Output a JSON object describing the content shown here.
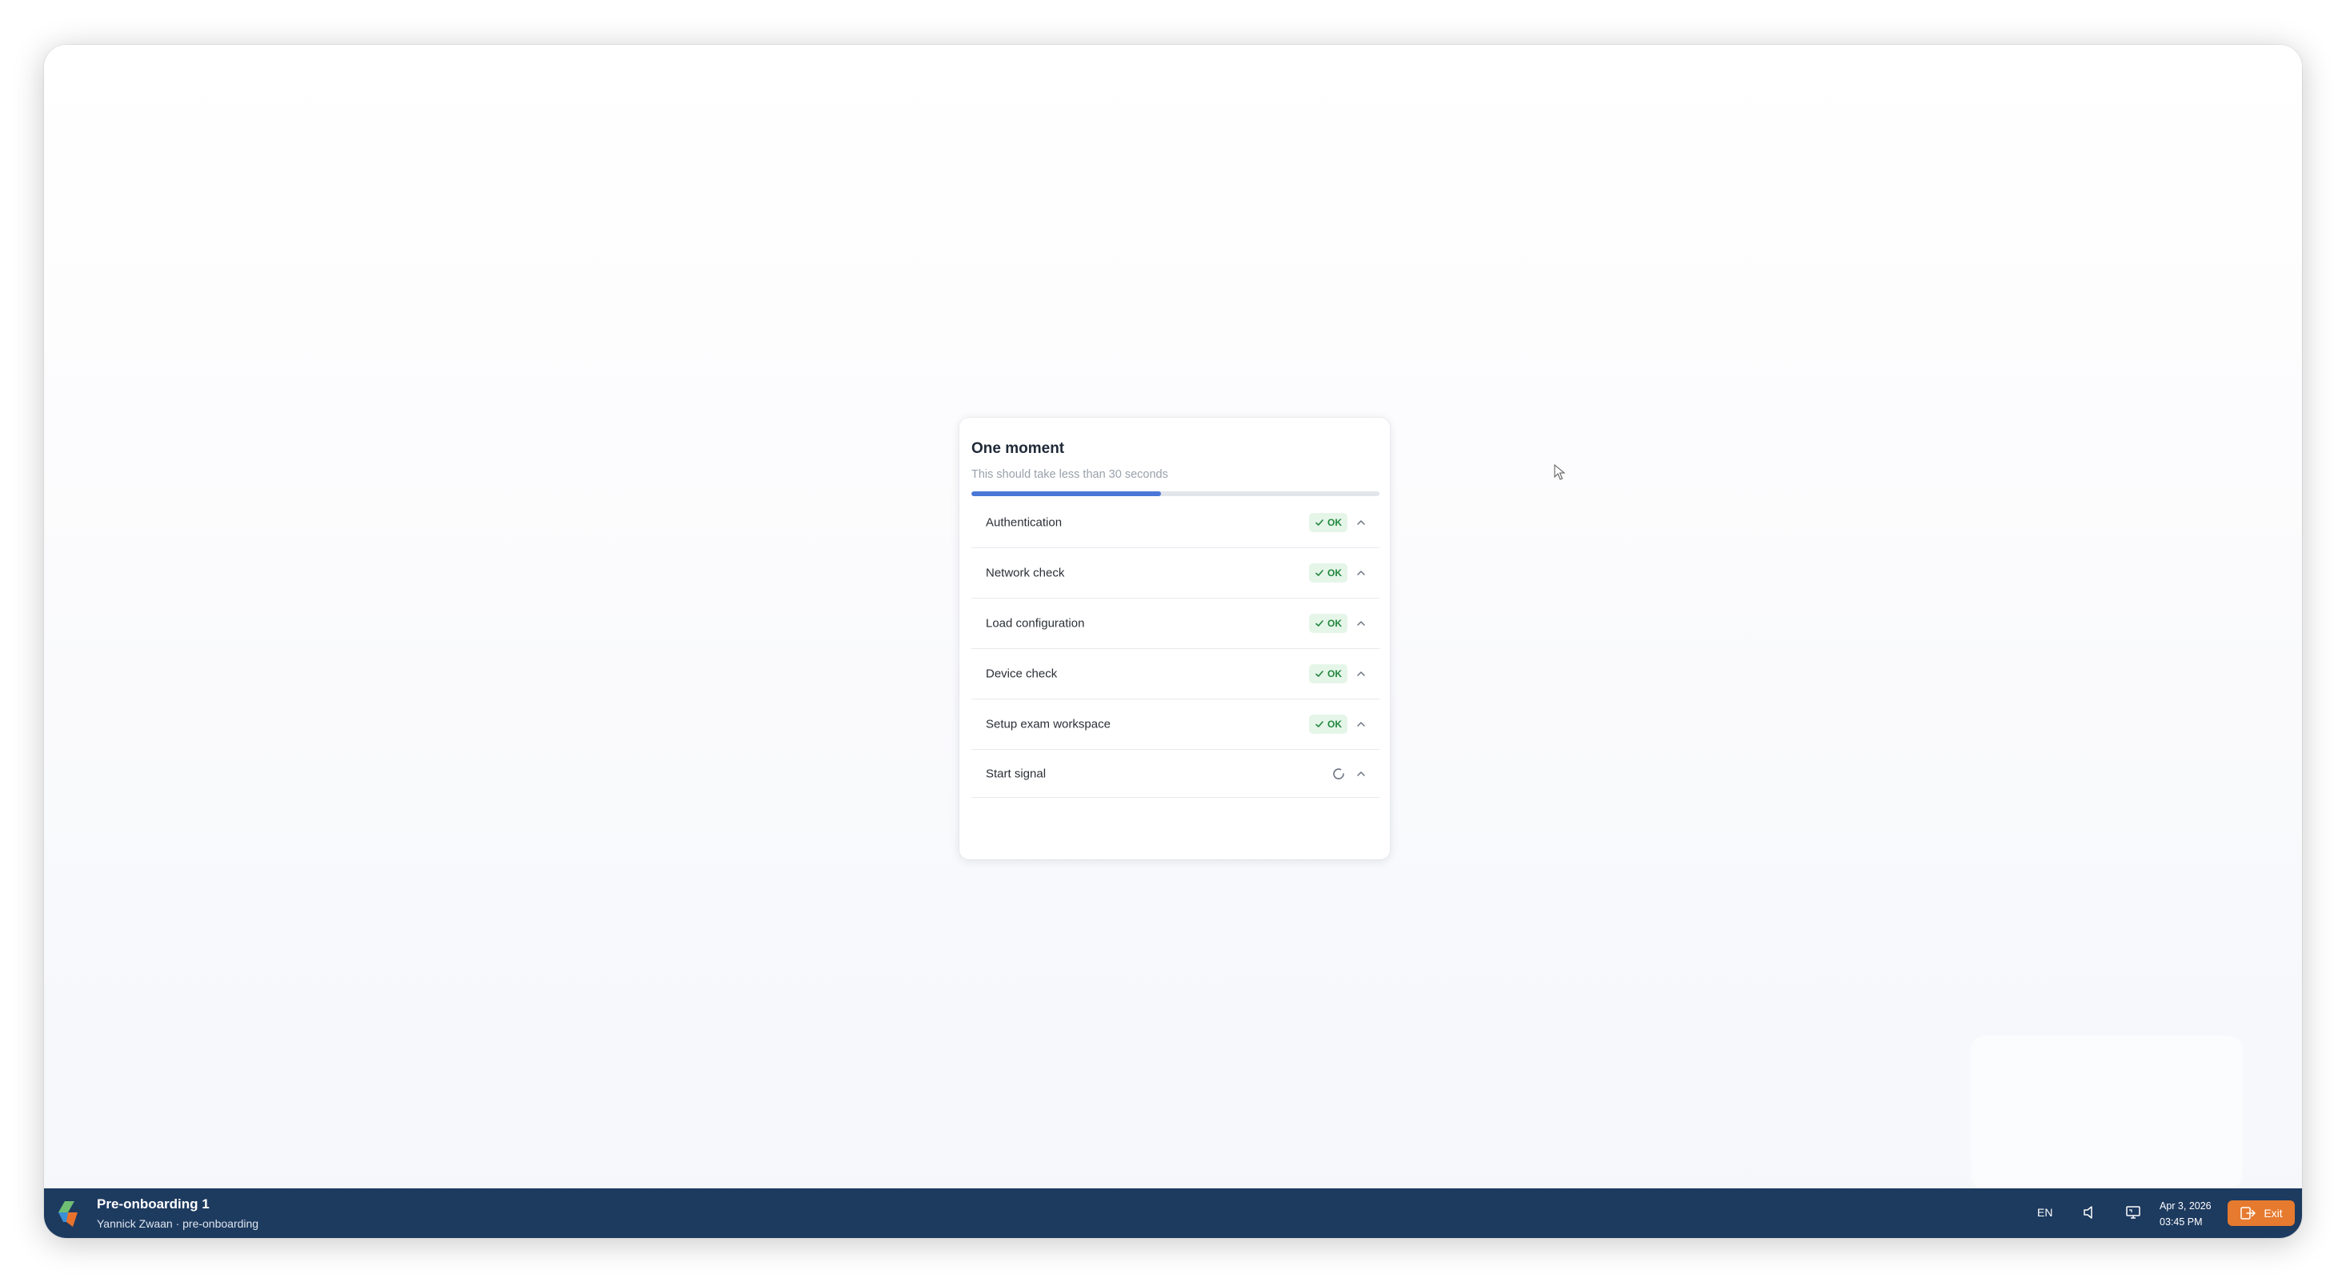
{
  "loading_card": {
    "title": "One moment",
    "subtitle": "This should take less than 30 seconds",
    "progress_fraction": 0.465,
    "steps": [
      {
        "label": "Authentication",
        "status": "OK"
      },
      {
        "label": "Network check",
        "status": "OK"
      },
      {
        "label": "Load configuration",
        "status": "OK"
      },
      {
        "label": "Device check",
        "status": "OK"
      },
      {
        "label": "Setup exam workspace",
        "status": "OK"
      },
      {
        "label": "Start signal",
        "status": "loading"
      }
    ]
  },
  "taskbar": {
    "app_title": "Pre-onboarding 1",
    "app_subtitle": "Yannick Zwaan · pre-onboarding",
    "language": "EN",
    "date": "Apr 3, 2026",
    "time": "03:45 PM",
    "exit_label": "Exit"
  },
  "colors": {
    "taskbar_bg": "#1d3a5f",
    "progress_fill": "#4a78d6",
    "ok_badge_bg": "#e5f6e9",
    "ok_badge_text": "#23873f",
    "exit_button": "#e67a2e"
  },
  "icons": {
    "ok": "check-icon",
    "expand": "chevron-up-icon",
    "loading": "spinner-icon",
    "volume": "speaker-icon",
    "display": "screen-icon",
    "exit": "logout-icon"
  }
}
